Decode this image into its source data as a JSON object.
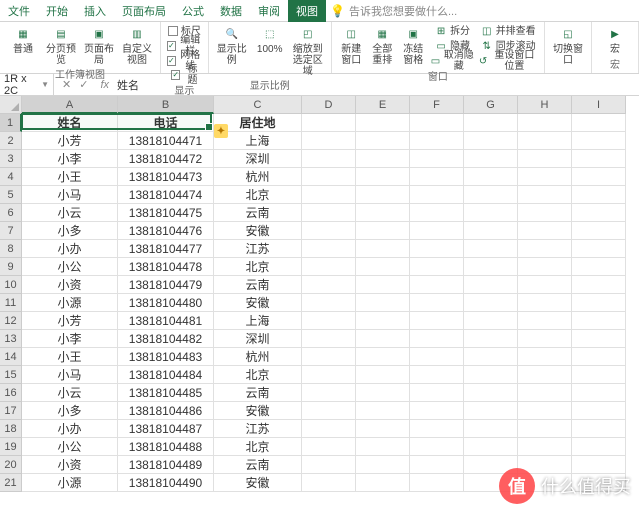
{
  "tabs": [
    "文件",
    "开始",
    "插入",
    "页面布局",
    "公式",
    "数据",
    "审阅",
    "视图"
  ],
  "active_tab": "视图",
  "tellme": "告诉我您想要做什么...",
  "ribbon": {
    "group1": {
      "btns": [
        "普通",
        "分页预览",
        "页面布局",
        "自定义视图"
      ],
      "label": "工作簿视图"
    },
    "group2": {
      "checks": [
        "标尺",
        "编辑栏",
        "网格线",
        "标题"
      ],
      "label": "显示"
    },
    "group3": {
      "btns": [
        "显示比例",
        "100%",
        "缩放到选定区域"
      ],
      "label": "显示比例"
    },
    "group4": {
      "btns": [
        "新建窗口",
        "全部重排",
        "冻结窗格"
      ],
      "side": [
        "拆分",
        "隐藏",
        "取消隐藏"
      ],
      "side2": [
        "并排查看",
        "同步滚动",
        "重设窗口位置"
      ],
      "label": "窗口"
    },
    "group5": {
      "btn": "切换窗口",
      "label": ""
    },
    "group6": {
      "btn": "宏",
      "label": "宏"
    }
  },
  "namebox": "1R x 2C",
  "formula_value": "姓名",
  "columns": [
    "A",
    "B",
    "C",
    "D",
    "E",
    "F",
    "G",
    "H",
    "I"
  ],
  "headers": {
    "a": "姓名",
    "b": "电话",
    "c": "居住地"
  },
  "rows": [
    {
      "n": 1
    },
    {
      "n": 2,
      "a": "小芳",
      "b": "13818104471",
      "c": "上海"
    },
    {
      "n": 3,
      "a": "小李",
      "b": "13818104472",
      "c": "深圳"
    },
    {
      "n": 4,
      "a": "小王",
      "b": "13818104473",
      "c": "杭州"
    },
    {
      "n": 5,
      "a": "小马",
      "b": "13818104474",
      "c": "北京"
    },
    {
      "n": 6,
      "a": "小云",
      "b": "13818104475",
      "c": "云南"
    },
    {
      "n": 7,
      "a": "小多",
      "b": "13818104476",
      "c": "安徽"
    },
    {
      "n": 8,
      "a": "小办",
      "b": "13818104477",
      "c": "江苏"
    },
    {
      "n": 9,
      "a": "小公",
      "b": "13818104478",
      "c": "北京"
    },
    {
      "n": 10,
      "a": "小资",
      "b": "13818104479",
      "c": "云南"
    },
    {
      "n": 11,
      "a": "小源",
      "b": "13818104480",
      "c": "安徽"
    },
    {
      "n": 12,
      "a": "小芳",
      "b": "13818104481",
      "c": "上海"
    },
    {
      "n": 13,
      "a": "小李",
      "b": "13818104482",
      "c": "深圳"
    },
    {
      "n": 14,
      "a": "小王",
      "b": "13818104483",
      "c": "杭州"
    },
    {
      "n": 15,
      "a": "小马",
      "b": "13818104484",
      "c": "北京"
    },
    {
      "n": 16,
      "a": "小云",
      "b": "13818104485",
      "c": "云南"
    },
    {
      "n": 17,
      "a": "小多",
      "b": "13818104486",
      "c": "安徽"
    },
    {
      "n": 18,
      "a": "小办",
      "b": "13818104487",
      "c": "江苏"
    },
    {
      "n": 19,
      "a": "小公",
      "b": "13818104488",
      "c": "北京"
    },
    {
      "n": 20,
      "a": "小资",
      "b": "13818104489",
      "c": "云南"
    },
    {
      "n": 21,
      "a": "小源",
      "b": "13818104490",
      "c": "安徽"
    }
  ],
  "watermark": {
    "badge": "值",
    "text": "什么值得买"
  }
}
